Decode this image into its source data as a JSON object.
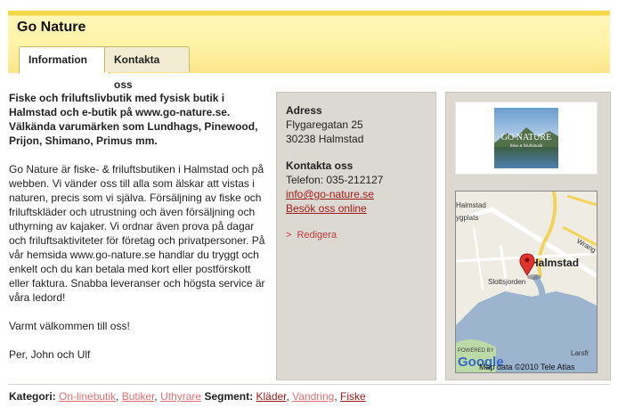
{
  "header": {
    "title": "Go Nature"
  },
  "tabs": [
    {
      "label": "Information"
    },
    {
      "label": "Kontakta oss"
    }
  ],
  "description": {
    "lead": "Fiske och friluftslivbutik med fysisk butik i Halmstad och e-butik på www.go-nature.se. Välkända varumärken som Lundhags, Pinewood, Prijon, Shimano, Primus mm.",
    "body": "Go Nature är fiske- & friluftsbutiken i Halmstad och på webben. Vi vänder oss till alla som älskar att vistas i naturen, precis som vi själva. Försäljning av fiske och friluftskläder och utrustning och även försäljning och uthyrning av kajaker. Vi ordnar även prova på dagar och friluftsaktiviteter för företag och privatpersoner. På vår hemsida www.go-nature.se handlar du tryggt och enkelt och du kan betala med kort eller postförskott eller faktura. Snabba leveranser och högsta service är våra ledord!",
    "greeting": "Varmt välkommen till oss!",
    "signature": "Per, John och Ulf"
  },
  "contact": {
    "address_heading": "Adress",
    "street": "Flygaregatan 25",
    "city": "30238 Halmstad",
    "contact_heading": "Kontakta oss",
    "phone": "Telefon: 035-212127",
    "email": "info@go-nature.se",
    "visit_link": "Besök oss online",
    "edit_link": "Redigera"
  },
  "logo": {
    "line1": "GO NATURE",
    "line2": "fiske & friluftsbutik"
  },
  "map": {
    "city_label": "Halmstad",
    "area_label": "Slottsjorden",
    "label_wrang": "Wrang",
    "label_larsfr": "Larsfr",
    "label_ygplats": "ygplats",
    "label_halmstad_small": "Halmstad",
    "powered_by": "POWERED BY",
    "google": "Google",
    "copyright": "Map data ©2010 Tele Atlas"
  },
  "footer": {
    "category_label": "Kategori:",
    "categories": [
      "On-linebutik",
      "Butiker",
      "Uthyrare"
    ],
    "segment_label": "Segment:",
    "segments": [
      "Kläder",
      "Vandring",
      "Fiske"
    ]
  },
  "colors": {
    "header_yellow": "#f3d94a",
    "link_red": "#a01a1a",
    "link_pink": "#e07070",
    "panel_gray": "#dcd9d2"
  }
}
